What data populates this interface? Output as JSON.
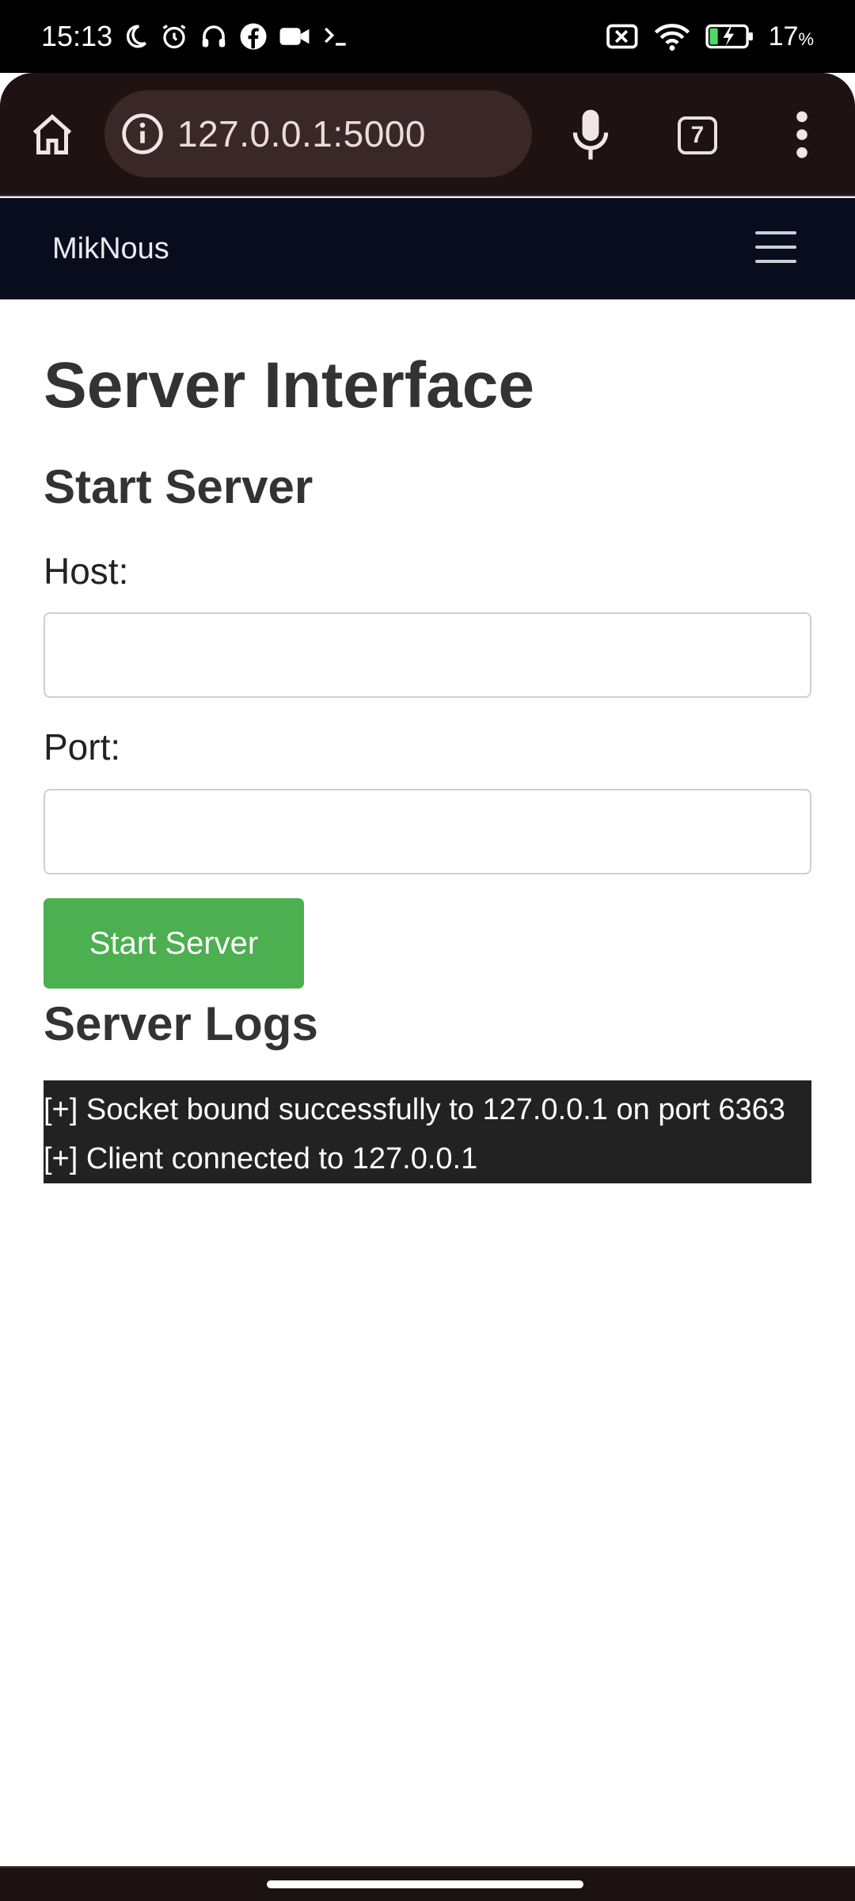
{
  "status_bar": {
    "time": "15:13",
    "battery_percent": "17",
    "battery_unit": "%",
    "icons": [
      "moon-icon",
      "alarm-icon",
      "headphones-icon",
      "facebook-icon",
      "video-camera-icon",
      "terminal-icon",
      "sim-off-icon",
      "wifi-icon",
      "battery-charging-icon"
    ]
  },
  "browser": {
    "url": "127.0.0.1:5000",
    "tab_count": "7"
  },
  "navbar": {
    "brand": "MikNous"
  },
  "page": {
    "title": "Server Interface",
    "start_section_title": "Start Server",
    "host_label": "Host:",
    "host_value": "",
    "port_label": "Port:",
    "port_value": "",
    "start_button": "Start Server",
    "logs_title": "Server Logs",
    "logs": [
      "[+] Socket bound successfully to 127.0.0.1 on port 6363",
      "[+] Client connected to 127.0.0.1"
    ]
  },
  "colors": {
    "navbar_bg": "#080d1d",
    "button_green": "#4caf50",
    "logs_bg": "#222222"
  }
}
